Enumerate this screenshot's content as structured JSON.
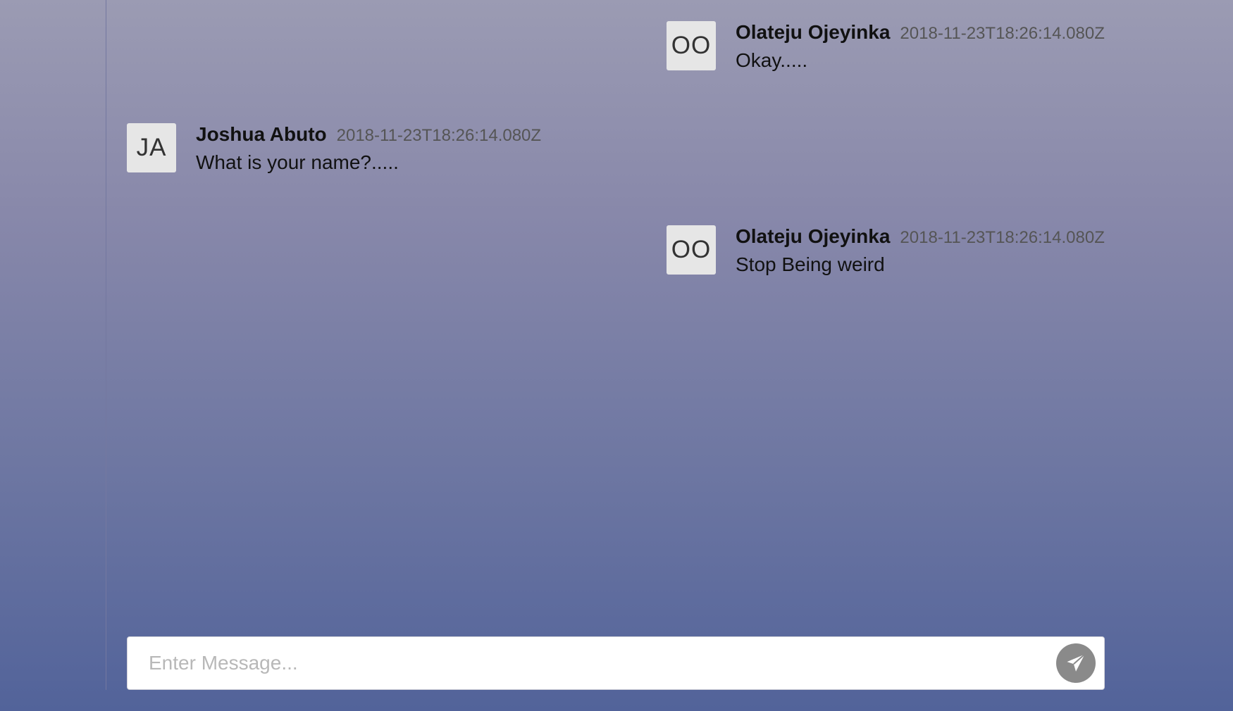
{
  "messages": [
    {
      "initials": "OO",
      "author": "Olateju Ojeyinka",
      "timestamp": "2018-11-23T18:26:14.080Z",
      "text": "Okay....."
    },
    {
      "initials": "JA",
      "author": "Joshua Abuto",
      "timestamp": "2018-11-23T18:26:14.080Z",
      "text": "What is your name?....."
    },
    {
      "initials": "OO",
      "author": "Olateju Ojeyinka",
      "timestamp": "2018-11-23T18:26:14.080Z",
      "text": "Stop Being weird"
    }
  ],
  "composer": {
    "placeholder": "Enter Message...",
    "value": "",
    "send_icon": "send-paper-plane-icon"
  }
}
